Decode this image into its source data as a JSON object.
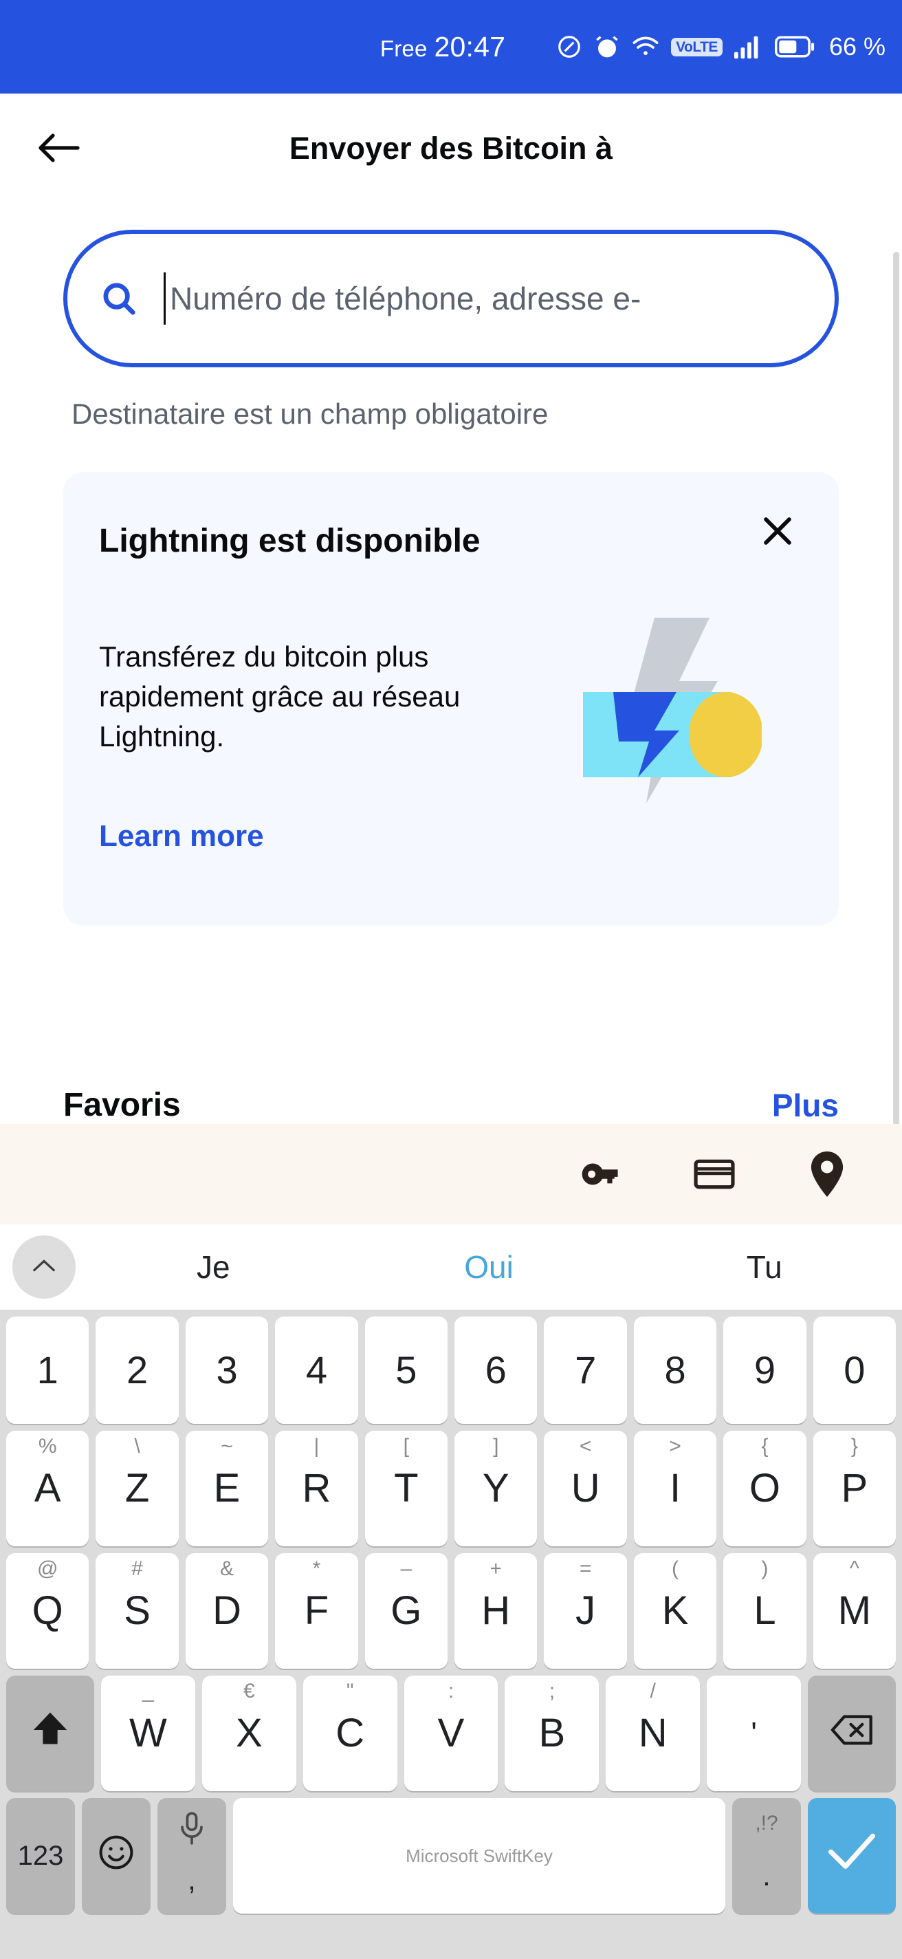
{
  "status_bar": {
    "carrier": "Free",
    "clock": "20:47",
    "icons": [
      "data-saver-icon",
      "alarm-icon",
      "wifi-icon",
      "volte-icon",
      "signal-icon",
      "battery-icon"
    ],
    "volte_label": "VoLTE",
    "battery_percent": "66 %",
    "background_color": "#2553DF"
  },
  "app": {
    "back_icon": "back-arrow-icon",
    "title": "Envoyer des Bitcoin à",
    "search": {
      "icon": "search-icon",
      "value": "",
      "placeholder": "Numéro de téléphone, adresse e-",
      "border_color": "#2553DF"
    },
    "helper_text": "Destinataire est un champ obligatoire",
    "promo": {
      "title": "Lightning est disponible",
      "description": "Transférez du bitcoin plus rapidement grâce au réseau Lightning.",
      "link_label": "Learn more",
      "close_icon": "close-icon",
      "art_icon": "lightning-bolt-illustration",
      "background_color": "#F5F8FF",
      "link_color": "#2553DF"
    },
    "section": {
      "title": "Favoris",
      "action_label": "Plus"
    }
  },
  "autofill_bar": {
    "icons": [
      "key-icon",
      "credit-card-icon",
      "location-pin-icon"
    ],
    "background_color": "#FCF6F1"
  },
  "keyboard": {
    "expand_icon": "chevron-up-icon",
    "suggestions": [
      {
        "label": "Je",
        "active": false
      },
      {
        "label": "Oui",
        "active": true
      },
      {
        "label": "Tu",
        "active": false
      }
    ],
    "row_numbers": [
      {
        "main": "1"
      },
      {
        "main": "2"
      },
      {
        "main": "3"
      },
      {
        "main": "4"
      },
      {
        "main": "5"
      },
      {
        "main": "6"
      },
      {
        "main": "7"
      },
      {
        "main": "8"
      },
      {
        "main": "9"
      },
      {
        "main": "0"
      }
    ],
    "row_top": [
      {
        "main": "A",
        "sup": "%"
      },
      {
        "main": "Z",
        "sup": "\\"
      },
      {
        "main": "E",
        "sup": "~"
      },
      {
        "main": "R",
        "sup": "|"
      },
      {
        "main": "T",
        "sup": "["
      },
      {
        "main": "Y",
        "sup": "]"
      },
      {
        "main": "U",
        "sup": "<"
      },
      {
        "main": "I",
        "sup": ">"
      },
      {
        "main": "O",
        "sup": "{"
      },
      {
        "main": "P",
        "sup": "}"
      }
    ],
    "row_home": [
      {
        "main": "Q",
        "sup": "@"
      },
      {
        "main": "S",
        "sup": "#"
      },
      {
        "main": "D",
        "sup": "&"
      },
      {
        "main": "F",
        "sup": "*"
      },
      {
        "main": "G",
        "sup": "–"
      },
      {
        "main": "H",
        "sup": "+"
      },
      {
        "main": "J",
        "sup": "="
      },
      {
        "main": "K",
        "sup": "("
      },
      {
        "main": "L",
        "sup": ")"
      },
      {
        "main": "M",
        "sup": "^"
      }
    ],
    "row_bottom_letters": [
      {
        "main": "W",
        "sup": "_"
      },
      {
        "main": "X",
        "sup": "€"
      },
      {
        "main": "C",
        "sup": "\""
      },
      {
        "main": "V",
        "sup": ":"
      },
      {
        "main": "B",
        "sup": ";"
      },
      {
        "main": "N",
        "sup": "/"
      },
      {
        "main": "'",
        "sup": ""
      }
    ],
    "shift_icon": "shift-up-icon",
    "backspace_icon": "backspace-icon",
    "numeric_label": "123",
    "emoji_icon": "emoji-smiley-icon",
    "mic_icon": "microphone-icon",
    "mic_sub_label": ",",
    "space_label": "Microsoft SwiftKey",
    "punct_top_label": ",!?",
    "punct_bottom_label": ".",
    "enter_icon": "checkmark-icon",
    "enter_color": "#52ADE0"
  }
}
